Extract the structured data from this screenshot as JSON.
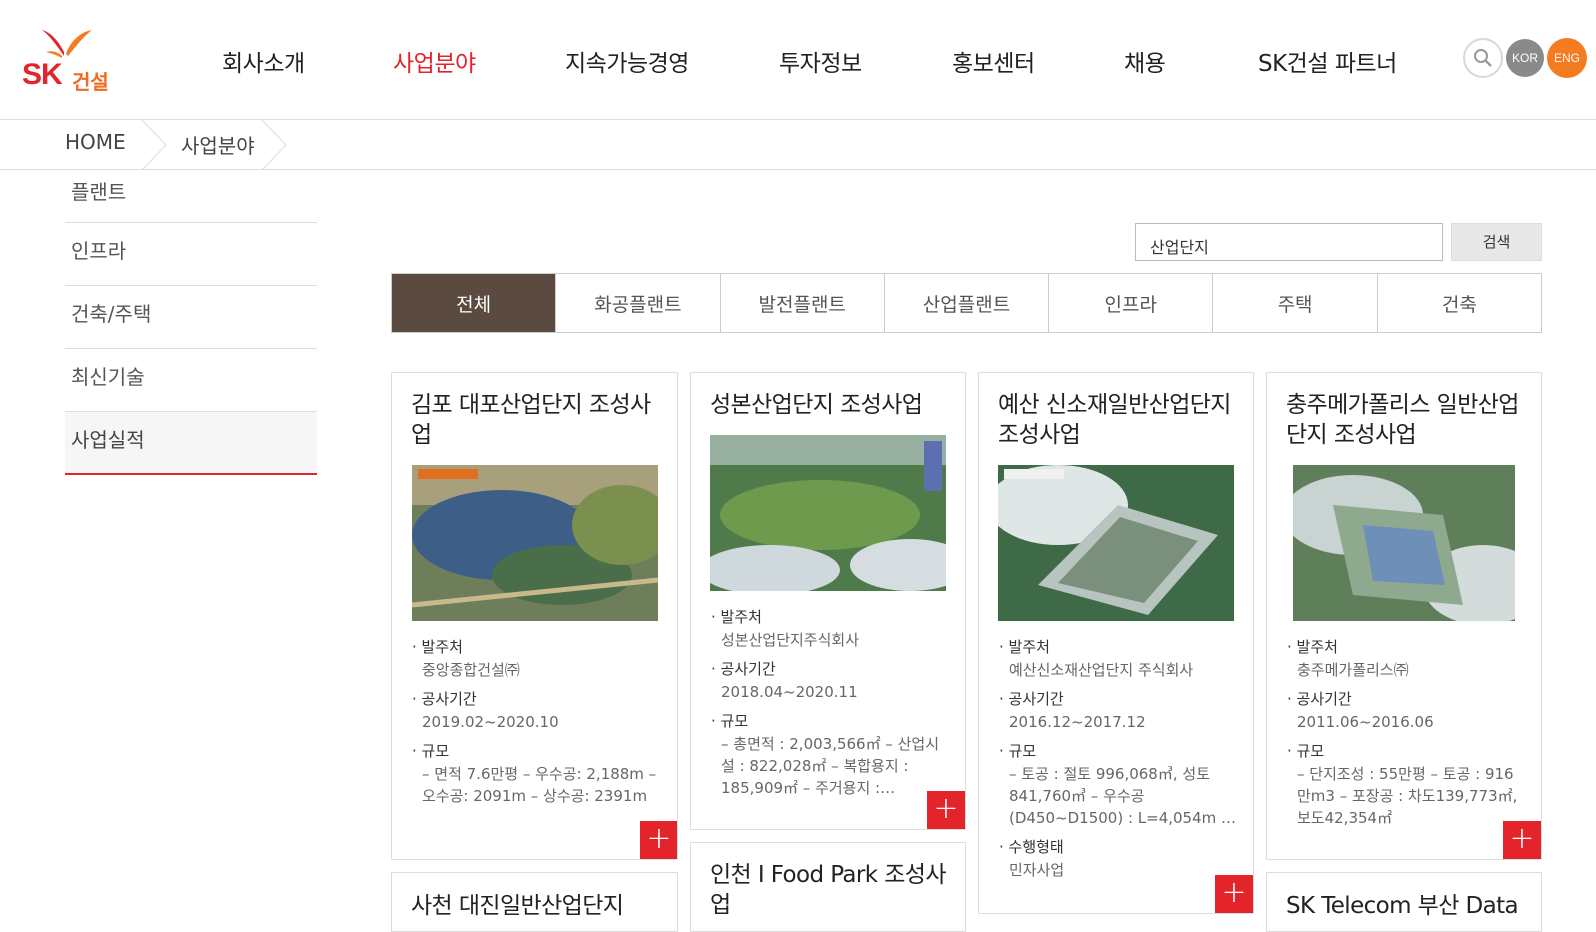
{
  "header": {
    "logo_sk": "SK",
    "logo_kr": "건설",
    "nav": [
      "회사소개",
      "사업분야",
      "지속가능경영",
      "투자정보",
      "홍보센터",
      "채용",
      "SK건설 파트너"
    ],
    "kor_label": "KOR",
    "eng_label": "ENG"
  },
  "breadcrumb": [
    "HOME",
    "사업분야"
  ],
  "sidebar": {
    "items": [
      "플랜트",
      "인프라",
      "건축/주택",
      "최신기술",
      "사업실적"
    ],
    "active": "사업실적"
  },
  "search": {
    "value": "산업단지",
    "button_label": "검색"
  },
  "tabs": [
    "전체",
    "화공플랜트",
    "발전플랜트",
    "산업플랜트",
    "인프라",
    "주택",
    "건축"
  ],
  "active_tab": "전체",
  "labels": {
    "client": "· 발주처",
    "period": "· 공사기간",
    "scale": "· 규모",
    "type": "· 수행형태"
  },
  "projects": [
    {
      "title": "김포 대포산업단지 조성사업",
      "client": "중앙종합건설㈜",
      "period": "2019.02~2020.10",
      "scale": "– 면적 7.6만평 – 우수공: 2,188m – 오수공: 2091m – 상수공: 2391m"
    },
    {
      "title": "성본산업단지 조성사업",
      "client": "성본산업단지주식회사",
      "period": "2018.04~2020.11",
      "scale": "– 총면적 : 2,003,566㎡ – 산업시설 : 822,028㎡ – 복합용지 : 185,909㎡ – 주거용지 :…"
    },
    {
      "title": "예산 신소재일반산업단지 조성사업",
      "client": "예산신소재산업단지 주식회사",
      "period": "2016.12~2017.12",
      "scale": "– 토공 : 절토 996,068㎥, 성토 841,760㎥ – 우수공 (D450~D1500) : L=4,054m …",
      "type": "민자사업"
    },
    {
      "title": "충주메가폴리스 일반산업단지 조성사업",
      "client": "충주메가폴리스㈜",
      "period": "2011.06~2016.06",
      "scale": "– 단지조성 : 55만평 – 토공 : 916만m3 – 포장공 : 차도139,773㎡, 보도42,354㎡"
    },
    {
      "title": "사천 대진일반산업단지"
    },
    {
      "title": "인천 I Food Park 조성사업"
    },
    {
      "title": "SK Telecom 부산 Data"
    }
  ],
  "colors": {
    "brand_red": "#e3242b",
    "brand_orange": "#f57b20",
    "active_tab_bg": "#5a4a3f"
  }
}
